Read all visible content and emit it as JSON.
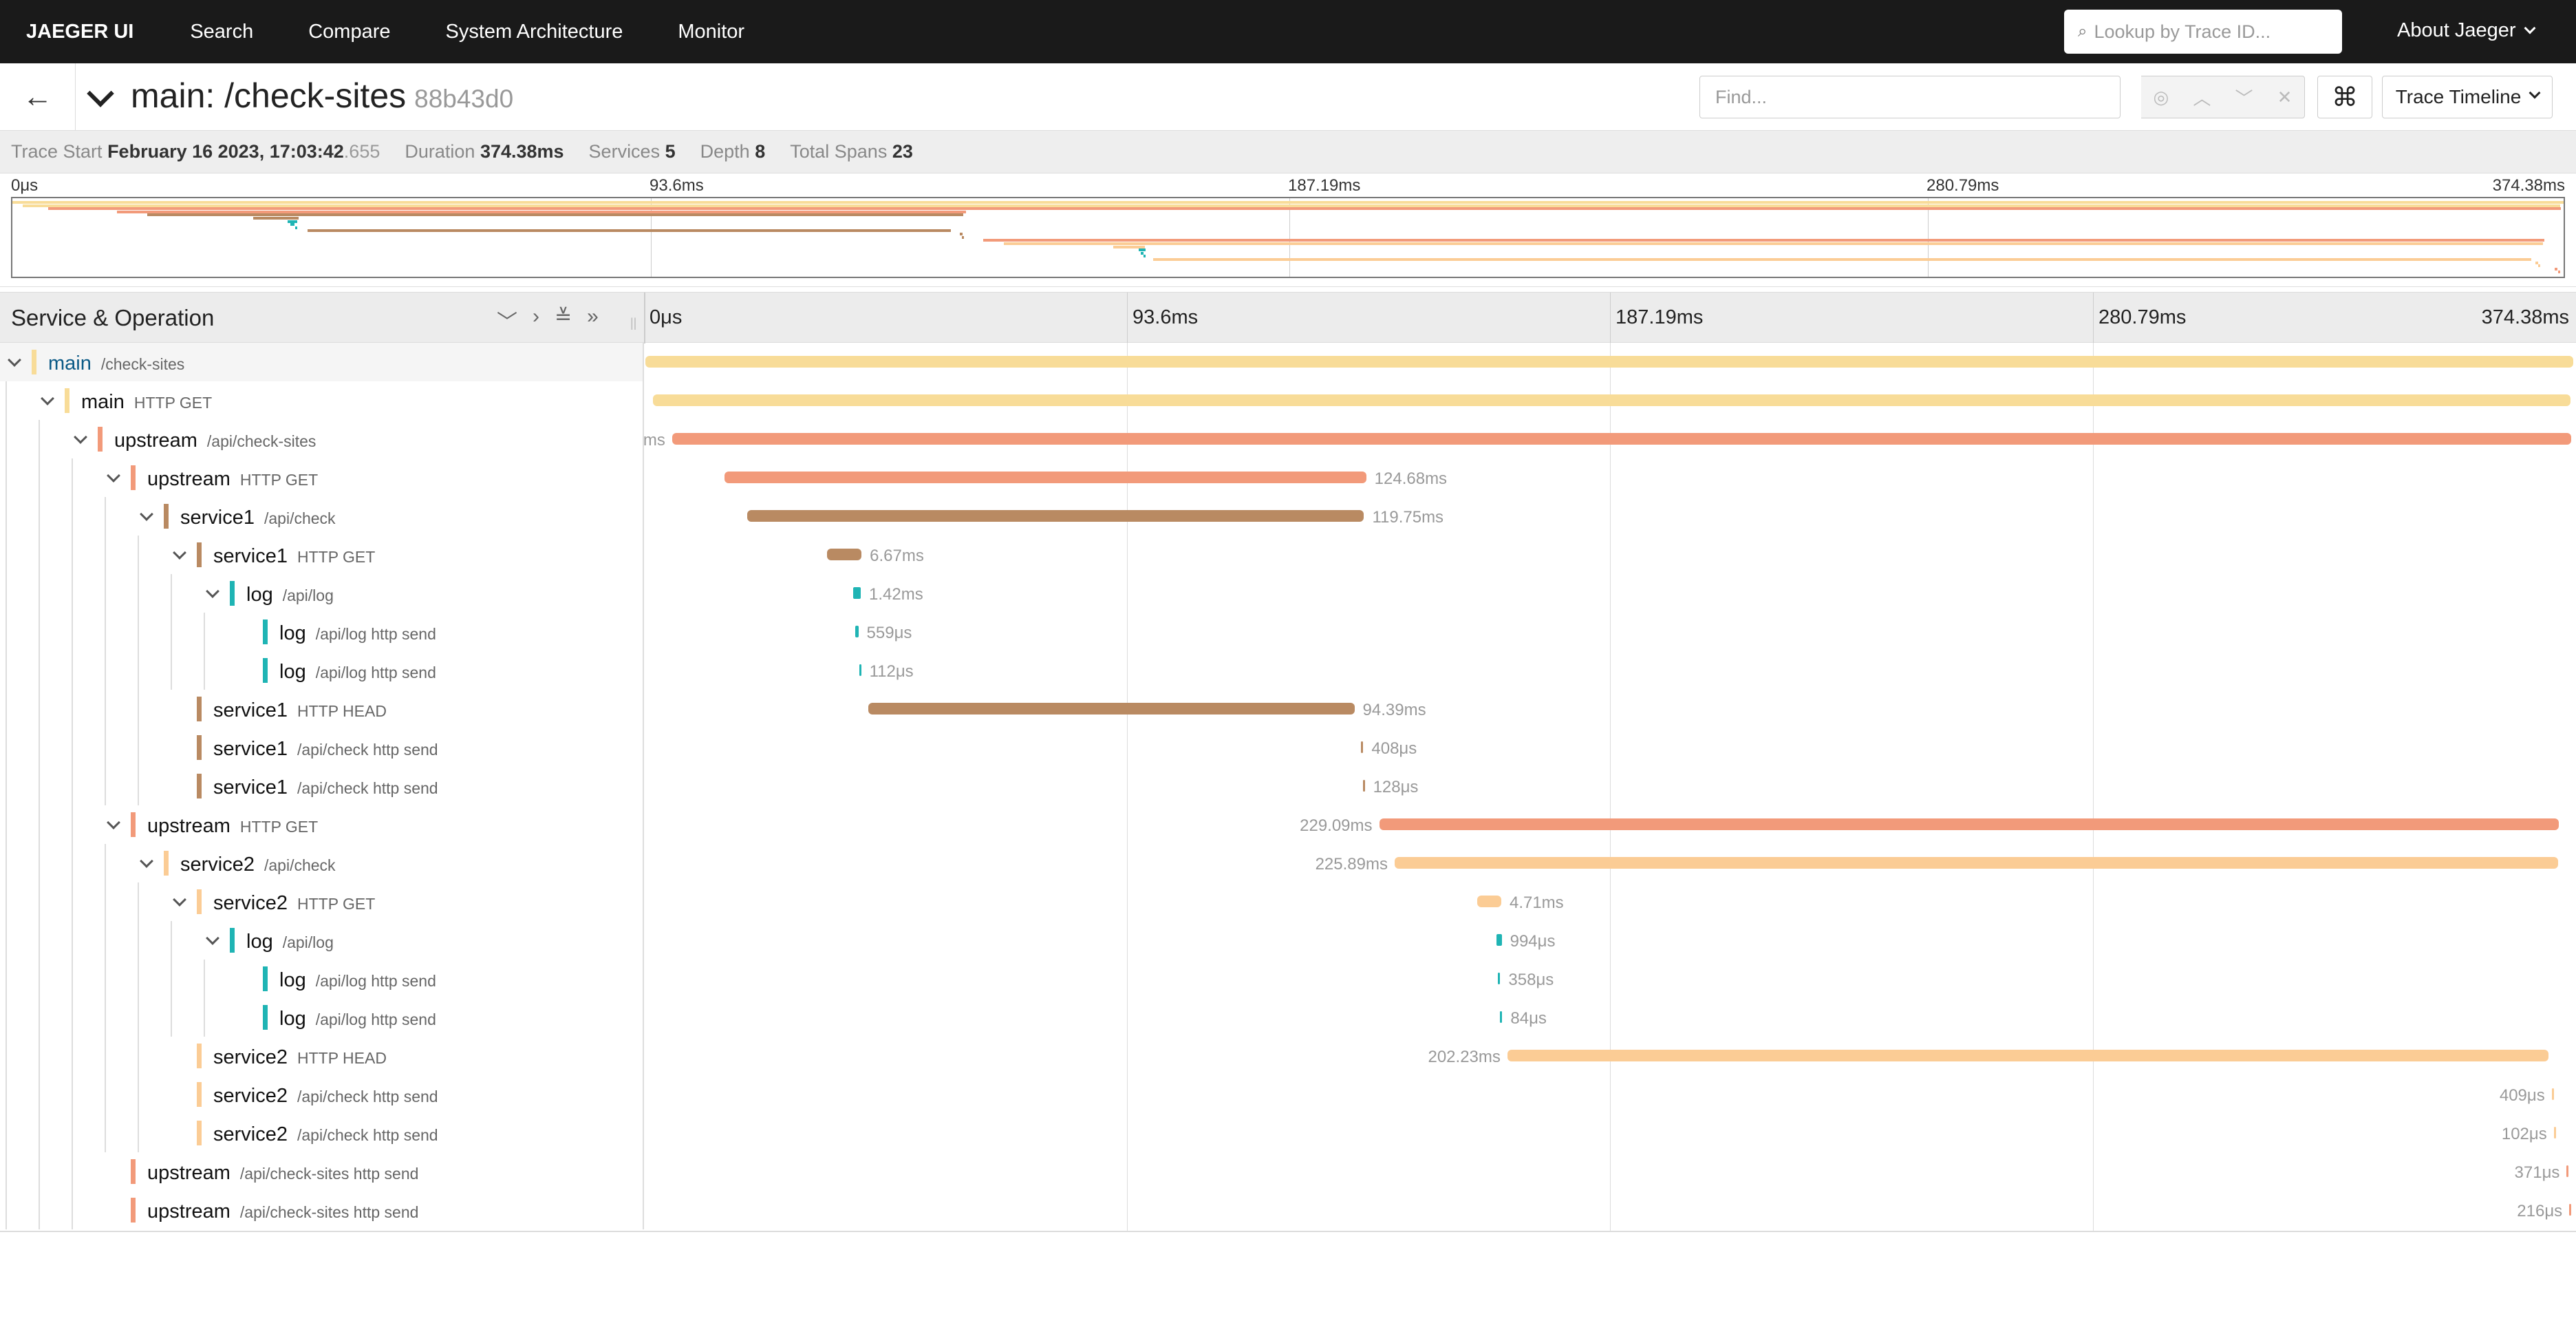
{
  "nav": {
    "brand": "JAEGER UI",
    "links": [
      "Search",
      "Compare",
      "System Architecture",
      "Monitor"
    ],
    "lookup_placeholder": "Lookup by Trace ID...",
    "about": "About Jaeger"
  },
  "trace": {
    "title": "main: /check-sites",
    "trace_id": "88b43d0",
    "find_placeholder": "Find...",
    "view_selector": "Trace Timeline"
  },
  "summary": {
    "trace_start_label": "Trace Start",
    "trace_start_value": "February 16 2023, 17:03:42",
    "trace_start_ms": ".655",
    "duration_label": "Duration",
    "duration_value": "374.38ms",
    "services_label": "Services",
    "services_value": "5",
    "depth_label": "Depth",
    "depth_value": "8",
    "total_spans_label": "Total Spans",
    "total_spans_value": "23"
  },
  "ticks": [
    "0μs",
    "93.6ms",
    "187.19ms",
    "280.79ms",
    "374.38ms"
  ],
  "detail_header": {
    "title": "Service & Operation"
  },
  "colors": {
    "main": "#f8dc98",
    "upstream": "#f29a7a",
    "service1": "#b98a62",
    "log": "#1fb4b4",
    "service2": "#fbcc95"
  },
  "spans": [
    {
      "service": "main",
      "operation": "/check-sites",
      "depth": 0,
      "expanded": true,
      "color": "main",
      "start_ms": 0,
      "dur_ms": 374.38,
      "label": "",
      "label_side": "none"
    },
    {
      "service": "main",
      "operation": "HTTP GET",
      "depth": 1,
      "expanded": true,
      "color": "main",
      "start_ms": 1.5,
      "dur_ms": 372.4,
      "label": "",
      "label_side": "none"
    },
    {
      "service": "upstream",
      "operation": "/api/check-sites",
      "depth": 2,
      "expanded": true,
      "color": "upstream",
      "start_ms": 5.2,
      "dur_ms": 368.8,
      "label": "ms",
      "label_side": "left"
    },
    {
      "service": "upstream",
      "operation": "HTTP GET",
      "depth": 3,
      "expanded": true,
      "color": "upstream",
      "start_ms": 15.3,
      "dur_ms": 124.68,
      "label": "124.68ms",
      "label_side": "right"
    },
    {
      "service": "service1",
      "operation": "/api/check",
      "depth": 4,
      "expanded": true,
      "color": "service1",
      "start_ms": 19.8,
      "dur_ms": 119.75,
      "label": "119.75ms",
      "label_side": "right"
    },
    {
      "service": "service1",
      "operation": "HTTP GET",
      "depth": 5,
      "expanded": true,
      "color": "service1",
      "start_ms": 35.3,
      "dur_ms": 6.67,
      "label": "6.67ms",
      "label_side": "right"
    },
    {
      "service": "log",
      "operation": "/api/log",
      "depth": 6,
      "expanded": true,
      "color": "log",
      "start_ms": 40.4,
      "dur_ms": 1.42,
      "label": "1.42ms",
      "label_side": "right"
    },
    {
      "service": "log",
      "operation": "/api/log http send",
      "depth": 7,
      "expanded": false,
      "color": "log",
      "start_ms": 40.8,
      "dur_ms": 0.559,
      "label": "559μs",
      "label_side": "right"
    },
    {
      "service": "log",
      "operation": "/api/log http send",
      "depth": 7,
      "expanded": false,
      "color": "log",
      "start_ms": 41.5,
      "dur_ms": 0.112,
      "label": "112μs",
      "label_side": "right"
    },
    {
      "service": "service1",
      "operation": "HTTP HEAD",
      "depth": 5,
      "expanded": false,
      "color": "service1",
      "start_ms": 43.3,
      "dur_ms": 94.39,
      "label": "94.39ms",
      "label_side": "right"
    },
    {
      "service": "service1",
      "operation": "/api/check http send",
      "depth": 5,
      "expanded": false,
      "color": "service1",
      "start_ms": 139.0,
      "dur_ms": 0.408,
      "label": "408μs",
      "label_side": "right"
    },
    {
      "service": "service1",
      "operation": "/api/check http send",
      "depth": 5,
      "expanded": false,
      "color": "service1",
      "start_ms": 139.3,
      "dur_ms": 0.128,
      "label": "128μs",
      "label_side": "right"
    },
    {
      "service": "upstream",
      "operation": "HTTP GET",
      "depth": 3,
      "expanded": true,
      "color": "upstream",
      "start_ms": 142.5,
      "dur_ms": 229.09,
      "label": "229.09ms",
      "label_side": "left"
    },
    {
      "service": "service2",
      "operation": "/api/check",
      "depth": 4,
      "expanded": true,
      "color": "service2",
      "start_ms": 145.5,
      "dur_ms": 225.89,
      "label": "225.89ms",
      "label_side": "left"
    },
    {
      "service": "service2",
      "operation": "HTTP GET",
      "depth": 5,
      "expanded": true,
      "color": "service2",
      "start_ms": 161.5,
      "dur_ms": 4.71,
      "label": "4.71ms",
      "label_side": "right"
    },
    {
      "service": "log",
      "operation": "/api/log",
      "depth": 6,
      "expanded": true,
      "color": "log",
      "start_ms": 165.3,
      "dur_ms": 0.994,
      "label": "994μs",
      "label_side": "right"
    },
    {
      "service": "log",
      "operation": "/api/log http send",
      "depth": 7,
      "expanded": false,
      "color": "log",
      "start_ms": 165.6,
      "dur_ms": 0.358,
      "label": "358μs",
      "label_side": "right"
    },
    {
      "service": "log",
      "operation": "/api/log http send",
      "depth": 7,
      "expanded": false,
      "color": "log",
      "start_ms": 166.0,
      "dur_ms": 0.084,
      "label": "84μs",
      "label_side": "right"
    },
    {
      "service": "service2",
      "operation": "HTTP HEAD",
      "depth": 5,
      "expanded": false,
      "color": "service2",
      "start_ms": 167.4,
      "dur_ms": 202.23,
      "label": "202.23ms",
      "label_side": "left"
    },
    {
      "service": "service2",
      "operation": "/api/check http send",
      "depth": 5,
      "expanded": false,
      "color": "service2",
      "start_ms": 370.2,
      "dur_ms": 0.409,
      "label": "409μs",
      "label_side": "left"
    },
    {
      "service": "service2",
      "operation": "/api/check http send",
      "depth": 5,
      "expanded": false,
      "color": "service2",
      "start_ms": 370.6,
      "dur_ms": 0.102,
      "label": "102μs",
      "label_side": "left"
    },
    {
      "service": "upstream",
      "operation": "/api/check-sites http send",
      "depth": 3,
      "expanded": false,
      "color": "upstream",
      "start_ms": 373.1,
      "dur_ms": 0.371,
      "label": "371μs",
      "label_side": "left"
    },
    {
      "service": "upstream",
      "operation": "/api/check-sites http send",
      "depth": 3,
      "expanded": false,
      "color": "upstream",
      "start_ms": 373.6,
      "dur_ms": 0.216,
      "label": "216μs",
      "label_side": "left"
    }
  ]
}
